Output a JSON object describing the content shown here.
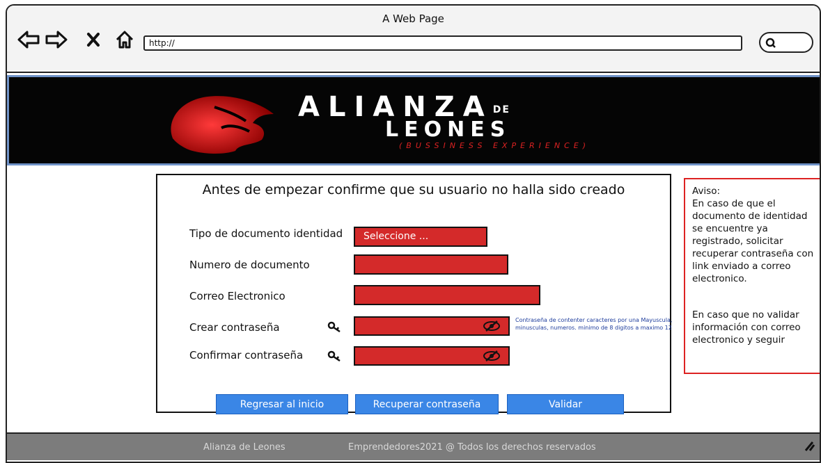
{
  "window": {
    "title": "A Web Page"
  },
  "toolbar": {
    "address_value": "http://",
    "icons": [
      "back-arrow-icon",
      "forward-arrow-icon",
      "close-icon",
      "home-icon",
      "search-icon"
    ]
  },
  "banner": {
    "title_main": "ALIANZA",
    "title_de": "DE",
    "title_second": "LEONES",
    "subtitle": "(BUSSINESS EXPERIENCE)",
    "logo_icon": "lion-logo-icon"
  },
  "form": {
    "heading": "Antes de empezar confirme que su usuario no halla sido creado",
    "doc_type_label": "Tipo de documento identidad",
    "doc_type_value": "Seleccione ...",
    "doc_number_label": "Numero de documento",
    "email_label": "Correo Electronico",
    "create_password_label": "Crear contraseña",
    "confirm_password_label": "Confirmar contraseña",
    "password_hint": "Contraseña de contenter caracteres por una Mayuscula, minusculas, numeros. minimo de 8 digitos a maximo 12",
    "buttons": {
      "back": "Regresar al inicio",
      "recover": "Recuperar contraseña",
      "validate": "Validar"
    }
  },
  "notice": {
    "title": "Aviso:",
    "paragraph1": "En caso de que el documento de identidad se encuentre ya registrado, solicitar recuperar contraseña con link enviado a correo electronico.",
    "paragraph2": "En caso que no validar información con correo electronico y seguir"
  },
  "footer": {
    "left": "Alianza de Leones",
    "right": "Emprendedores2021 @  Todos los derechos reservados"
  },
  "colors": {
    "field_red": "#d42a2a",
    "button_blue": "#3a86e6",
    "banner_border": "#6f92c8",
    "notice_border": "#dd2222",
    "footer_gray": "#7c7c7c"
  }
}
